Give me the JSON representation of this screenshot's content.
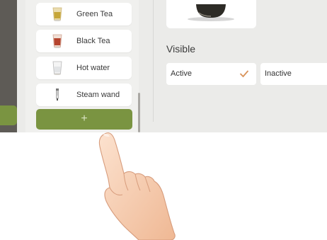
{
  "beverage_list": {
    "items": [
      {
        "label": "Green Tea",
        "icon": "green-tea-glass-icon"
      },
      {
        "label": "Black Tea",
        "icon": "black-tea-glass-icon"
      },
      {
        "label": "Hot water",
        "icon": "hot-water-glass-icon"
      },
      {
        "label": "Steam wand",
        "icon": "steam-wand-icon"
      }
    ],
    "add_label": "+"
  },
  "visible_setting": {
    "title": "Visible",
    "options": [
      {
        "label": "Active",
        "selected": true
      },
      {
        "label": "Inactive",
        "selected": false
      }
    ]
  },
  "colors": {
    "accent_green": "#7a9441",
    "check_orange": "#d9935a",
    "rail_dark": "#5e5b56",
    "background": "#ebebe9"
  }
}
